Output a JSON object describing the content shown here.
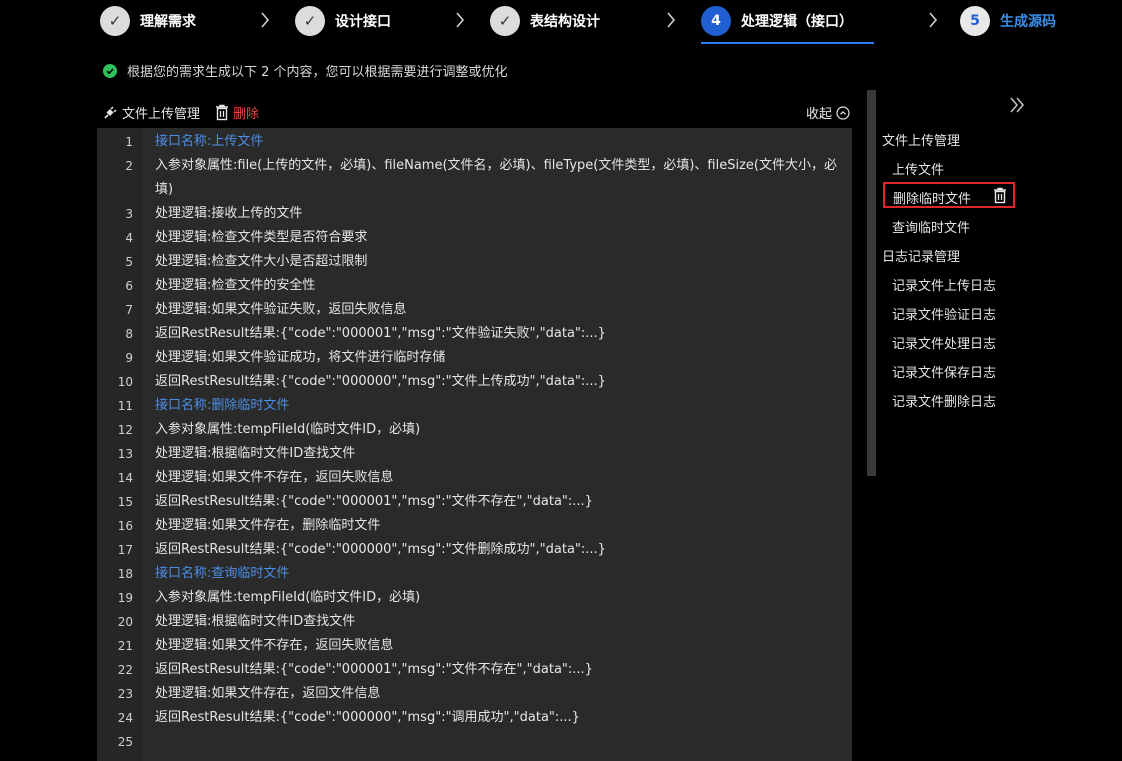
{
  "stepper": {
    "steps": [
      {
        "label": "理解需求",
        "status": "done",
        "badge": "✓"
      },
      {
        "label": "设计接口",
        "status": "done",
        "badge": "✓"
      },
      {
        "label": "表结构设计",
        "status": "done",
        "badge": "✓"
      },
      {
        "label": "处理逻辑（接口）",
        "status": "active",
        "badge": "4"
      },
      {
        "label": "生成源码",
        "status": "todo",
        "badge": "5"
      }
    ]
  },
  "notice": {
    "text": "根据您的需求生成以下 2 个内容，您可以根据需要进行调整或优化"
  },
  "toolbar": {
    "upload_label": "文件上传管理",
    "delete_label": "删除",
    "collapse_label": "收起"
  },
  "editor": {
    "lines": [
      {
        "n": "1",
        "text": "接口名称:上传文件",
        "highlight": true
      },
      {
        "n": "2",
        "text": "入参对象属性:file(上传的文件，必填)、fileName(文件名，必填)、fileType(文件类型，必填)、fileSize(文件大小，必填)",
        "highlight": false
      },
      {
        "n": "3",
        "text": "处理逻辑:接收上传的文件",
        "highlight": false
      },
      {
        "n": "4",
        "text": "处理逻辑:检查文件类型是否符合要求",
        "highlight": false
      },
      {
        "n": "5",
        "text": "处理逻辑:检查文件大小是否超过限制",
        "highlight": false
      },
      {
        "n": "6",
        "text": "处理逻辑:检查文件的安全性",
        "highlight": false
      },
      {
        "n": "7",
        "text": "处理逻辑:如果文件验证失败，返回失败信息",
        "highlight": false
      },
      {
        "n": "8",
        "text": "返回RestResult结果:{\"code\":\"000001\",\"msg\":\"文件验证失败\",\"data\":...}",
        "highlight": false
      },
      {
        "n": "9",
        "text": "处理逻辑:如果文件验证成功，将文件进行临时存储",
        "highlight": false
      },
      {
        "n": "10",
        "text": "返回RestResult结果:{\"code\":\"000000\",\"msg\":\"文件上传成功\",\"data\":...}",
        "highlight": false
      },
      {
        "n": "11",
        "text": "接口名称:删除临时文件",
        "highlight": true
      },
      {
        "n": "12",
        "text": "入参对象属性:tempFileId(临时文件ID，必填)",
        "highlight": false
      },
      {
        "n": "13",
        "text": "处理逻辑:根据临时文件ID查找文件",
        "highlight": false
      },
      {
        "n": "14",
        "text": "处理逻辑:如果文件不存在，返回失败信息",
        "highlight": false
      },
      {
        "n": "15",
        "text": "返回RestResult结果:{\"code\":\"000001\",\"msg\":\"文件不存在\",\"data\":...}",
        "highlight": false
      },
      {
        "n": "16",
        "text": "处理逻辑:如果文件存在，删除临时文件",
        "highlight": false
      },
      {
        "n": "17",
        "text": "返回RestResult结果:{\"code\":\"000000\",\"msg\":\"文件删除成功\",\"data\":...}",
        "highlight": false
      },
      {
        "n": "18",
        "text": "接口名称:查询临时文件",
        "highlight": true
      },
      {
        "n": "19",
        "text": "入参对象属性:tempFileId(临时文件ID，必填)",
        "highlight": false
      },
      {
        "n": "20",
        "text": "处理逻辑:根据临时文件ID查找文件",
        "highlight": false
      },
      {
        "n": "21",
        "text": "处理逻辑:如果文件不存在，返回失败信息",
        "highlight": false
      },
      {
        "n": "22",
        "text": "返回RestResult结果:{\"code\":\"000001\",\"msg\":\"文件不存在\",\"data\":...}",
        "highlight": false
      },
      {
        "n": "23",
        "text": "处理逻辑:如果文件存在，返回文件信息",
        "highlight": false
      },
      {
        "n": "24",
        "text": "返回RestResult结果:{\"code\":\"000000\",\"msg\":\"调用成功\",\"data\":...}",
        "highlight": false
      },
      {
        "n": "25",
        "text": "",
        "highlight": false
      }
    ]
  },
  "outline": {
    "group1_title": "文件上传管理",
    "group1_items": [
      "上传文件",
      "删除临时文件",
      "查询临时文件"
    ],
    "group2_title": "日志记录管理",
    "group2_items": [
      "记录文件上传日志",
      "记录文件验证日志",
      "记录文件处理日志",
      "记录文件保存日志",
      "记录文件删除日志"
    ]
  },
  "colors": {
    "accent": "#1f5fd1",
    "highlight_text": "#4d8fe6",
    "danger": "#e24b3b",
    "selected_border": "#e0262b",
    "success": "#2fbf5a"
  }
}
